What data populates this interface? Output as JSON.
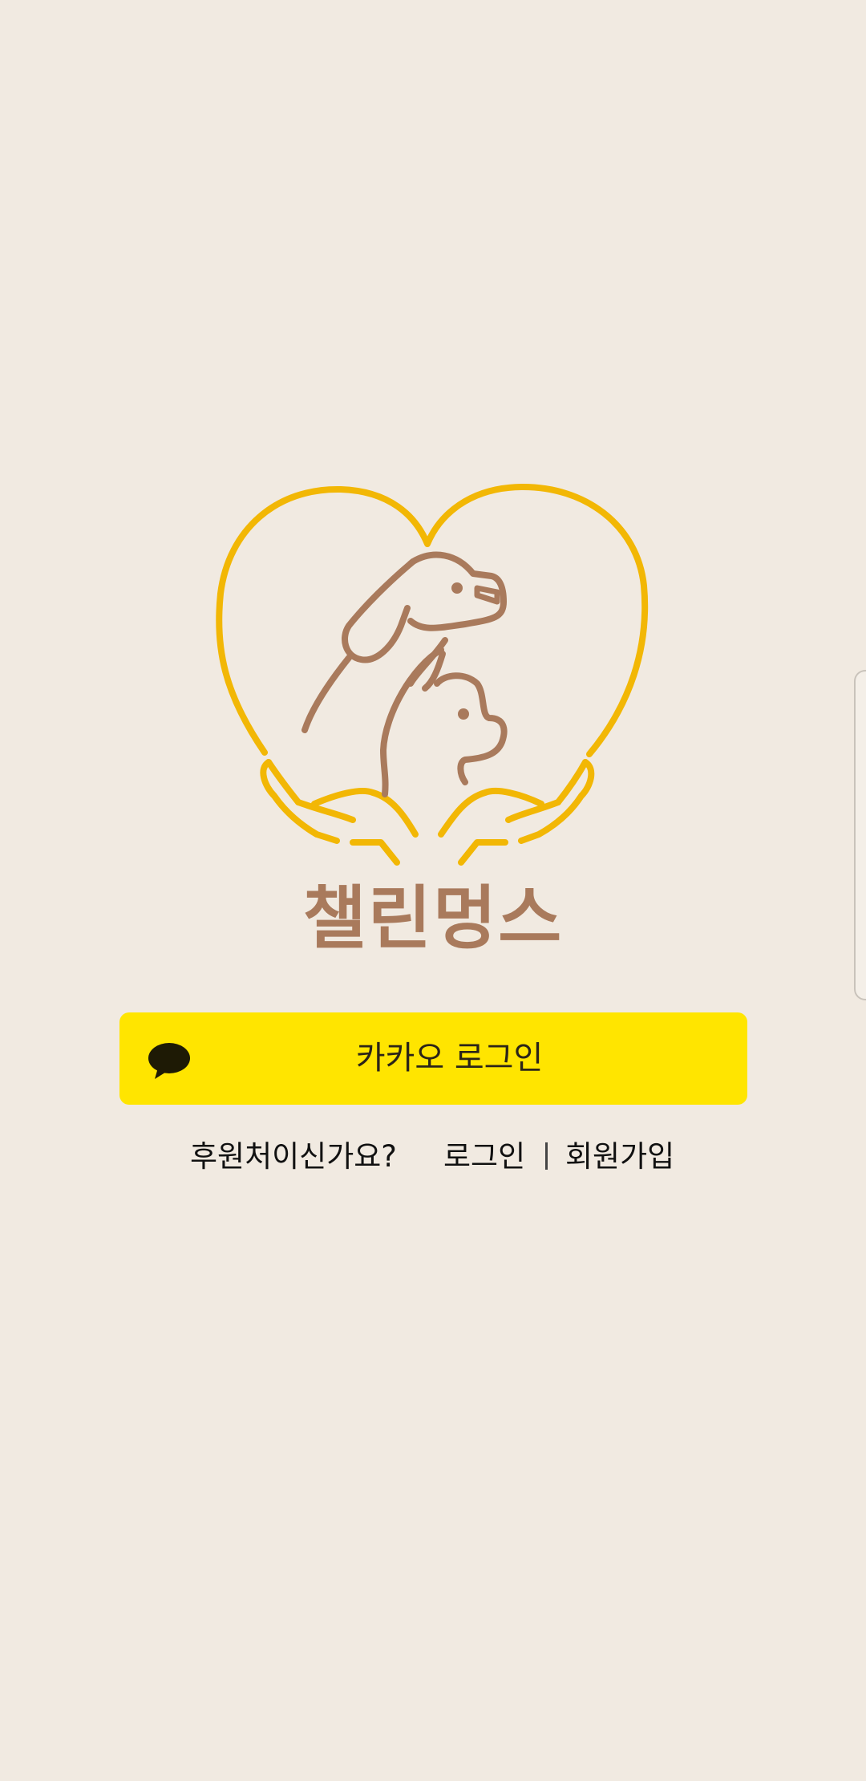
{
  "brand": {
    "name": "챌린멍스",
    "logo_icon": "heart-dogs-hands-logo"
  },
  "login": {
    "kakao_label": "카카오 로그인",
    "kakao_icon": "speech-bubble-icon"
  },
  "links": {
    "sponsor_question": "후원처이신가요?",
    "login": "로그인",
    "signup": "회원가입"
  },
  "colors": {
    "background": "#f1eae1",
    "brand_brown": "#a97a5c",
    "logo_yellow": "#f2b705",
    "kakao_yellow": "#ffe500"
  }
}
